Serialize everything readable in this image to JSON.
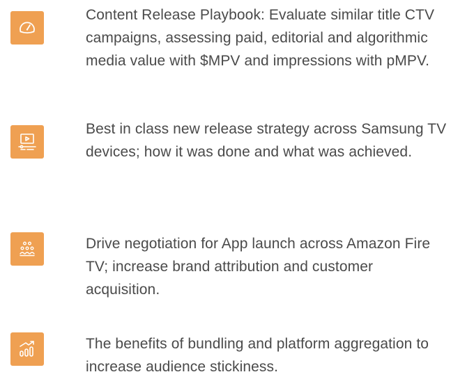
{
  "theme": {
    "icon_tile_color": "#EFA052",
    "icon_glyph_color": "#FFFFFF",
    "text_color": "#4A4A4A"
  },
  "features": [
    {
      "icon": "speedometer-icon",
      "text": "Content Release Playbook: Evaluate similar title CTV campaigns, assessing paid, editorial and algorithmic media value with $MPV and impressions with pMPV."
    },
    {
      "icon": "video-player-icon",
      "text": "Best in class new release strategy across Samsung TV devices; how it was done and what was achieved."
    },
    {
      "icon": "audience-group-icon",
      "text": "Drive negotiation for App launch across Amazon Fire TV; increase brand attribution and customer acquisition."
    },
    {
      "icon": "growth-chart-icon",
      "text": "The benefits of bundling and platform aggregation to increase audience stickiness."
    }
  ]
}
